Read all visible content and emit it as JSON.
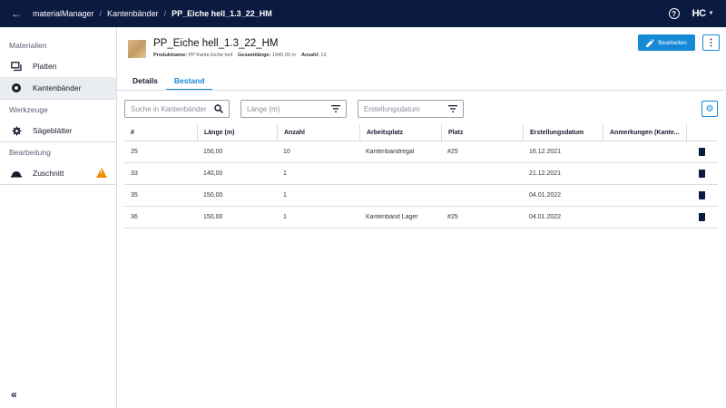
{
  "topbar": {
    "breadcrumbs": [
      "materialManager",
      "Kantenbänder",
      "PP_Eiche hell_1.3_22_HM"
    ],
    "logo": "HC"
  },
  "sidebar": {
    "sections": [
      {
        "title": "Materialien",
        "items": [
          {
            "label": "Platten",
            "icon": "panels-icon"
          },
          {
            "label": "Kantenbänder",
            "icon": "edgeband-roll-icon",
            "active": true
          }
        ]
      },
      {
        "title": "Werkzeuge",
        "items": [
          {
            "label": "Sägeblätter",
            "icon": "sawblade-icon"
          }
        ]
      },
      {
        "title": "Bearbeitung",
        "items": [
          {
            "label": "Zuschnitt",
            "icon": "cutting-icon",
            "warning": true
          }
        ]
      }
    ]
  },
  "header": {
    "title": "PP_Eiche hell_1.3_22_HM",
    "meta": [
      {
        "key": "Produktname:",
        "value": "PP Kante Eiche hell"
      },
      {
        "key": "Gesamtlänge:",
        "value": "1940,00 m"
      },
      {
        "key": "Anzahl:",
        "value": "13"
      }
    ],
    "edit_label": "Bearbeiten"
  },
  "tabs": [
    {
      "label": "Details",
      "active": false
    },
    {
      "label": "Bestand",
      "active": true
    }
  ],
  "filters": {
    "search_placeholder": "Suche in Kantenbänder",
    "length_placeholder": "Länge (m)",
    "date_placeholder": "Erstellungsdatum"
  },
  "table": {
    "columns": [
      "#",
      "Länge (m)",
      "Anzahl",
      "Arbeitsplatz",
      "Platz",
      "Erstellungsdatum",
      "Anmerkungen (Kante..."
    ],
    "rows": [
      [
        "25",
        "150,00",
        "10",
        "Kantenbandregal",
        "#25",
        "16.12.2021",
        ""
      ],
      [
        "33",
        "140,00",
        "1",
        "",
        "",
        "21.12.2021",
        ""
      ],
      [
        "35",
        "150,00",
        "1",
        "",
        "",
        "04.01.2022",
        ""
      ],
      [
        "36",
        "150,00",
        "1",
        "Kantenband Lager",
        "#25",
        "04.01.2022",
        ""
      ]
    ]
  },
  "colors": {
    "topbar": "#0b1a40",
    "accent": "#1689d6",
    "warning": "#f08c00"
  }
}
